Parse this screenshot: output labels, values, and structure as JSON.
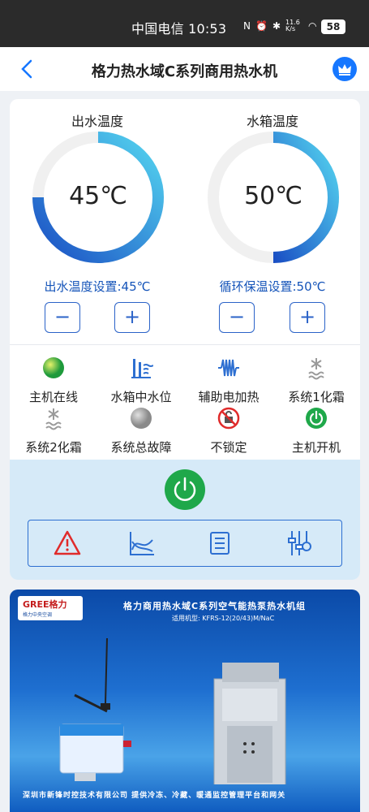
{
  "status_bar": {
    "carrier_time": "中国电信 10:53",
    "net_speed": "11.6 K/s",
    "signal": "5G",
    "battery": "58"
  },
  "nav": {
    "title": "格力热水域C系列商用热水机"
  },
  "gauges": [
    {
      "title": "出水温度",
      "value": "45℃",
      "setting": "出水温度设置:45℃"
    },
    {
      "title": "水箱温度",
      "value": "50℃",
      "setting": "循环保温设置:50℃"
    }
  ],
  "stepper": {
    "minus": "−",
    "plus": "+"
  },
  "status_items": [
    {
      "label": "主机在线",
      "icon": "online-dot-icon"
    },
    {
      "label": "水箱中水位",
      "icon": "water-level-icon"
    },
    {
      "label": "辅助电加热",
      "icon": "electric-heating-icon"
    },
    {
      "label": "系统1化霜",
      "icon": "defrost-icon"
    },
    {
      "label": "系统2化霜",
      "icon": "defrost-icon"
    },
    {
      "label": "系统总故障",
      "icon": "fault-dot-icon"
    },
    {
      "label": "不锁定",
      "icon": "unlocked-icon"
    },
    {
      "label": "主机开机",
      "icon": "power-on-icon"
    }
  ],
  "banner": {
    "logo_text": "GREE格力",
    "logo_sub": "格力中央空调",
    "headline": "格力商用热水域C系列空气能热泵热水机组",
    "model": "适用机型: KFRS-12(20/43)M/NaC",
    "footer": "深圳市新锋时控技术有限公司   提供冷冻、冷藏、暖通监控管理平台和网关"
  },
  "colors": {
    "accent": "#1677ff",
    "gauge_start": "#1a4fc4",
    "gauge_end": "#55d6f0",
    "power_green": "#1fa84a",
    "control_bg": "#d6eaf8"
  }
}
